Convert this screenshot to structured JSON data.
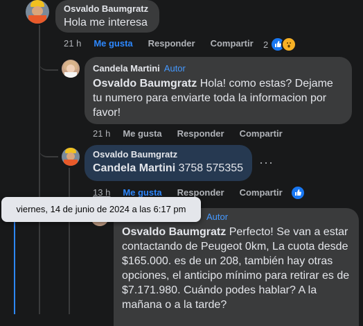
{
  "comment1": {
    "author": "Osvaldo Baumgratz",
    "text": "Hola me interesa",
    "time": "21 h",
    "like_label": "Me gusta",
    "reply_label": "Responder",
    "share_label": "Compartir",
    "reaction_count": "2"
  },
  "reply1": {
    "author": "Candela Martini",
    "badge": "Autor",
    "mention": "Osvaldo Baumgratz",
    "text": " Hola! como estas? Dejame tu numero para enviarte toda la informacion por favor!",
    "time": "21 h",
    "like_label": "Me gusta",
    "reply_label": "Responder",
    "share_label": "Compartir"
  },
  "reply2": {
    "author": "Osvaldo Baumgratz",
    "mention": "Candela Martini",
    "text": " 3758 575355",
    "time": "13 h",
    "like_label": "Me gusta",
    "reply_label": "Responder",
    "share_label": "Compartir",
    "more": "···"
  },
  "tooltip": "viernes, 14 de junio de 2024 a las 6:17 pm",
  "reply3": {
    "badge": "Autor",
    "mention": "Osvaldo Baumgratz",
    "text": " Perfecto! Se van a estar contactando de Peugeot 0km, La cuota desde $165.000. es de un 208, también hay otras opciones, el anticipo mínimo para retirar es de $7.171.980. Cuándo podes hablar? A la mañana o a la tarde?"
  },
  "colors": {
    "background": "#18191a",
    "bubble_grey": "#3a3b3c",
    "bubble_blue": "#263951",
    "accent": "#2d88ff"
  }
}
